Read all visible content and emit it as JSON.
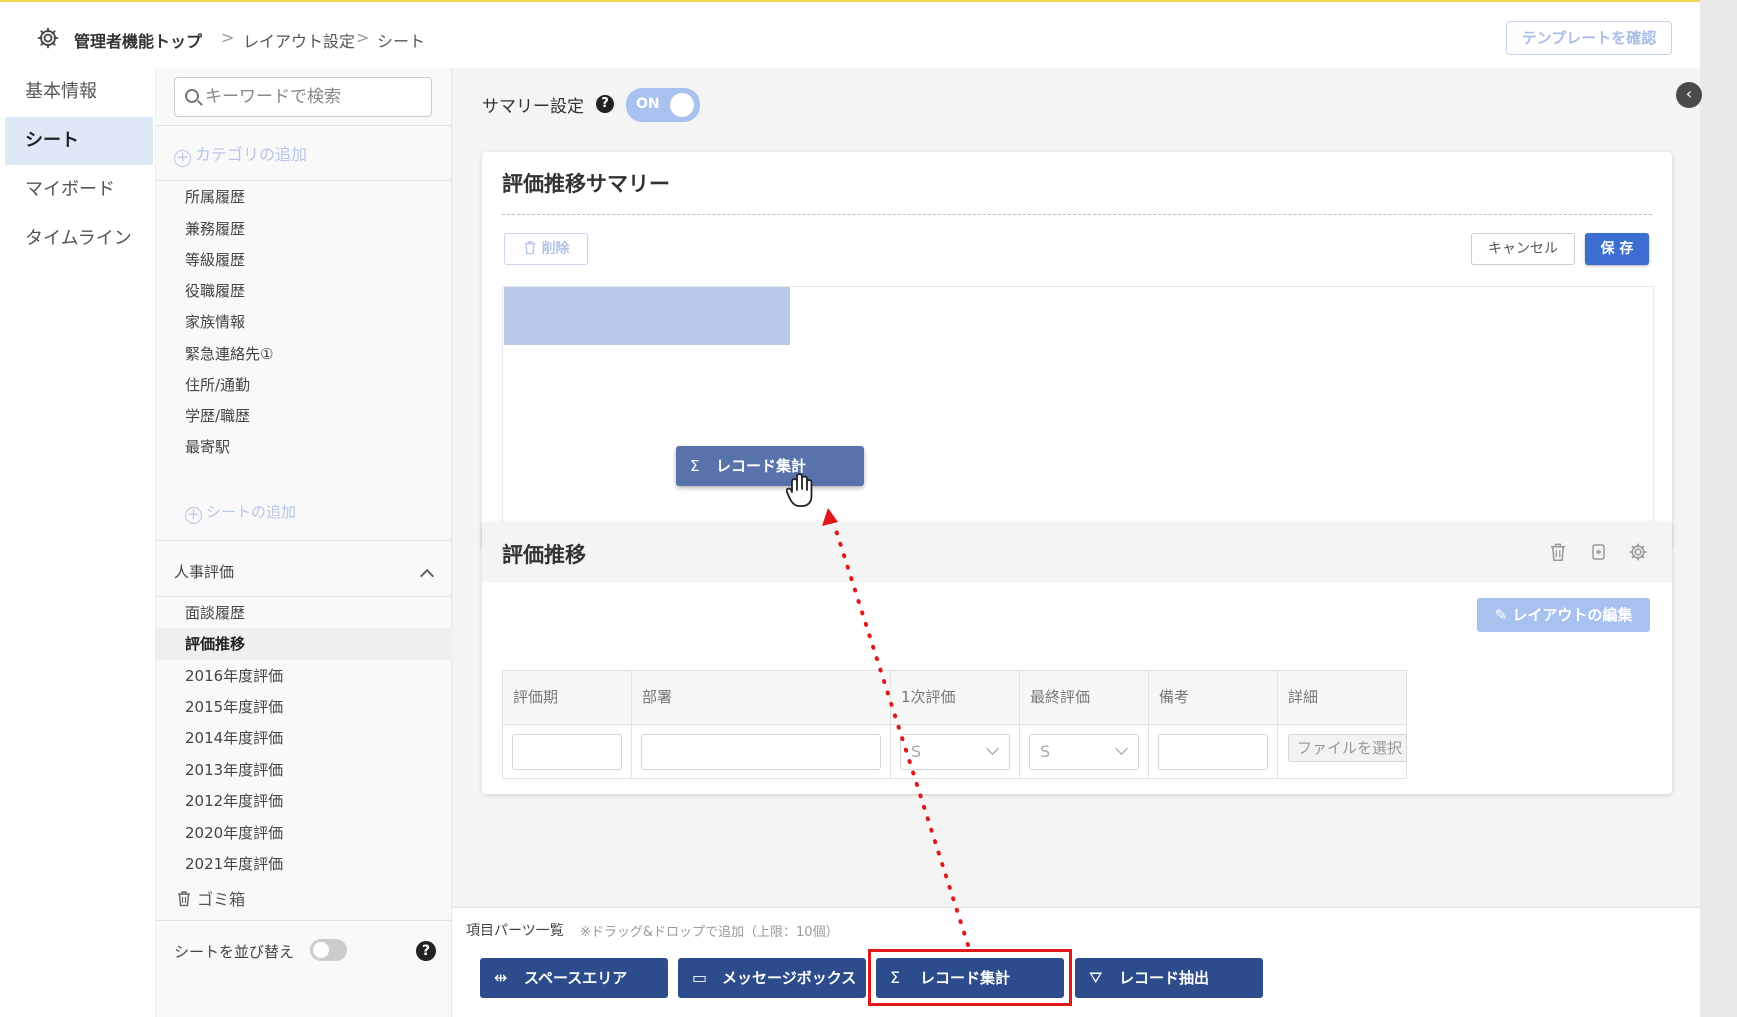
{
  "header": {
    "breadcrumb": [
      "管理者機能トップ",
      "レイアウト設定",
      "シート"
    ],
    "separator": ">",
    "template_button": "テンプレートを確認"
  },
  "primary_nav": {
    "items": [
      {
        "label": "基本情報",
        "active": false
      },
      {
        "label": "シート",
        "active": true
      },
      {
        "label": "マイボード",
        "active": false
      },
      {
        "label": "タイムライン",
        "active": false
      }
    ]
  },
  "sheet_nav": {
    "search_placeholder": "キーワードで検索",
    "add_category": "カテゴリの追加",
    "items": [
      "所属履歴",
      "兼務履歴",
      "等級履歴",
      "役職履歴",
      "家族情報",
      "緊急連絡先①",
      "住所/通勤",
      "学歴/職歴",
      "最寄駅"
    ],
    "add_sheet": "シートの追加",
    "group_name": "人事評価",
    "group_items": [
      {
        "label": "面談履歴",
        "active": false
      },
      {
        "label": "評価推移",
        "active": true
      },
      {
        "label": "2016年度評価",
        "active": false
      },
      {
        "label": "2015年度評価",
        "active": false
      },
      {
        "label": "2014年度評価",
        "active": false
      },
      {
        "label": "2013年度評価",
        "active": false
      },
      {
        "label": "2012年度評価",
        "active": false
      },
      {
        "label": "2020年度評価",
        "active": false
      },
      {
        "label": "2021年度評価",
        "active": false
      }
    ],
    "trash": "ゴミ箱",
    "reorder": "シートを並び替え"
  },
  "summary_setting": {
    "label": "サマリー設定",
    "toggle": "ON"
  },
  "summary_card": {
    "title": "評価推移サマリー",
    "delete": "削除",
    "cancel": "キャンセル",
    "save": "保 存",
    "dragged_item": "レコード集計"
  },
  "record_card": {
    "title": "評価推移",
    "edit_layout": "レイアウトの編集",
    "columns": [
      "評価期",
      "部署",
      "1次評価",
      "最終評価",
      "備考",
      "詳細"
    ],
    "select_value_1": "S",
    "select_value_2": "S",
    "file_button": "ファイルを選択"
  },
  "parts": {
    "title": "項目パーツ一覧",
    "note": "※ドラッグ&ドロップで追加（上限：10個）",
    "items": [
      {
        "label": "スペースエリア",
        "icon": "space-area-icon"
      },
      {
        "label": "メッセージボックス",
        "icon": "message-box-icon"
      },
      {
        "label": "レコード集計",
        "icon": "sigma-icon"
      },
      {
        "label": "レコード抽出",
        "icon": "extract-icon"
      }
    ]
  },
  "colors": {
    "accent": "#3c6ed1",
    "part_button": "#2d4c8c",
    "highlight": "#e0181a",
    "drop_zone": "#b9c9ec"
  }
}
